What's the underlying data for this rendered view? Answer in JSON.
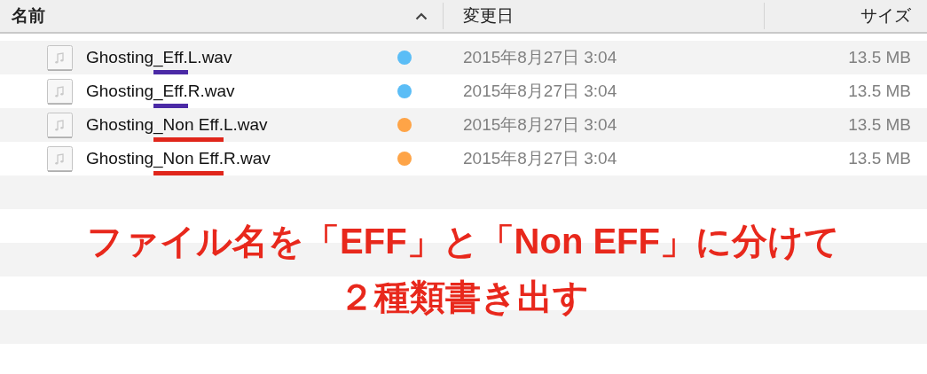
{
  "columns": [
    {
      "label": "名前",
      "sorted": true
    },
    {
      "label": "変更日",
      "sorted": false
    },
    {
      "label": "サイズ",
      "sorted": false
    }
  ],
  "files": [
    {
      "name_parts": [
        "Ghosting",
        "_Eff.",
        "L.wav"
      ],
      "underline": {
        "color": "#4b2aa6"
      },
      "tag": {
        "color": "#5bbdf6"
      },
      "modified": "2015年8月27日 3:04",
      "size": "13.5 MB"
    },
    {
      "name_parts": [
        "Ghosting",
        "_Eff.",
        "R.wav"
      ],
      "underline": {
        "color": "#4b2aa6"
      },
      "tag": {
        "color": "#5bbdf6"
      },
      "modified": "2015年8月27日 3:04",
      "size": "13.5 MB"
    },
    {
      "name_parts": [
        "Ghosting",
        "_Non Eff.",
        "L.wav"
      ],
      "underline": {
        "color": "#e0261b"
      },
      "tag": {
        "color": "#fea447"
      },
      "modified": "2015年8月27日 3:04",
      "size": "13.5 MB"
    },
    {
      "name_parts": [
        "Ghosting",
        "_Non Eff.",
        "R.wav"
      ],
      "underline": {
        "color": "#e0261b"
      },
      "tag": {
        "color": "#fea447"
      },
      "modified": "2015年8月27日 3:04",
      "size": "13.5 MB"
    }
  ],
  "annotation": {
    "lines": [
      "ファイル名を「EFF」と「Non EFF」に分けて",
      "２種類書き出す"
    ]
  }
}
